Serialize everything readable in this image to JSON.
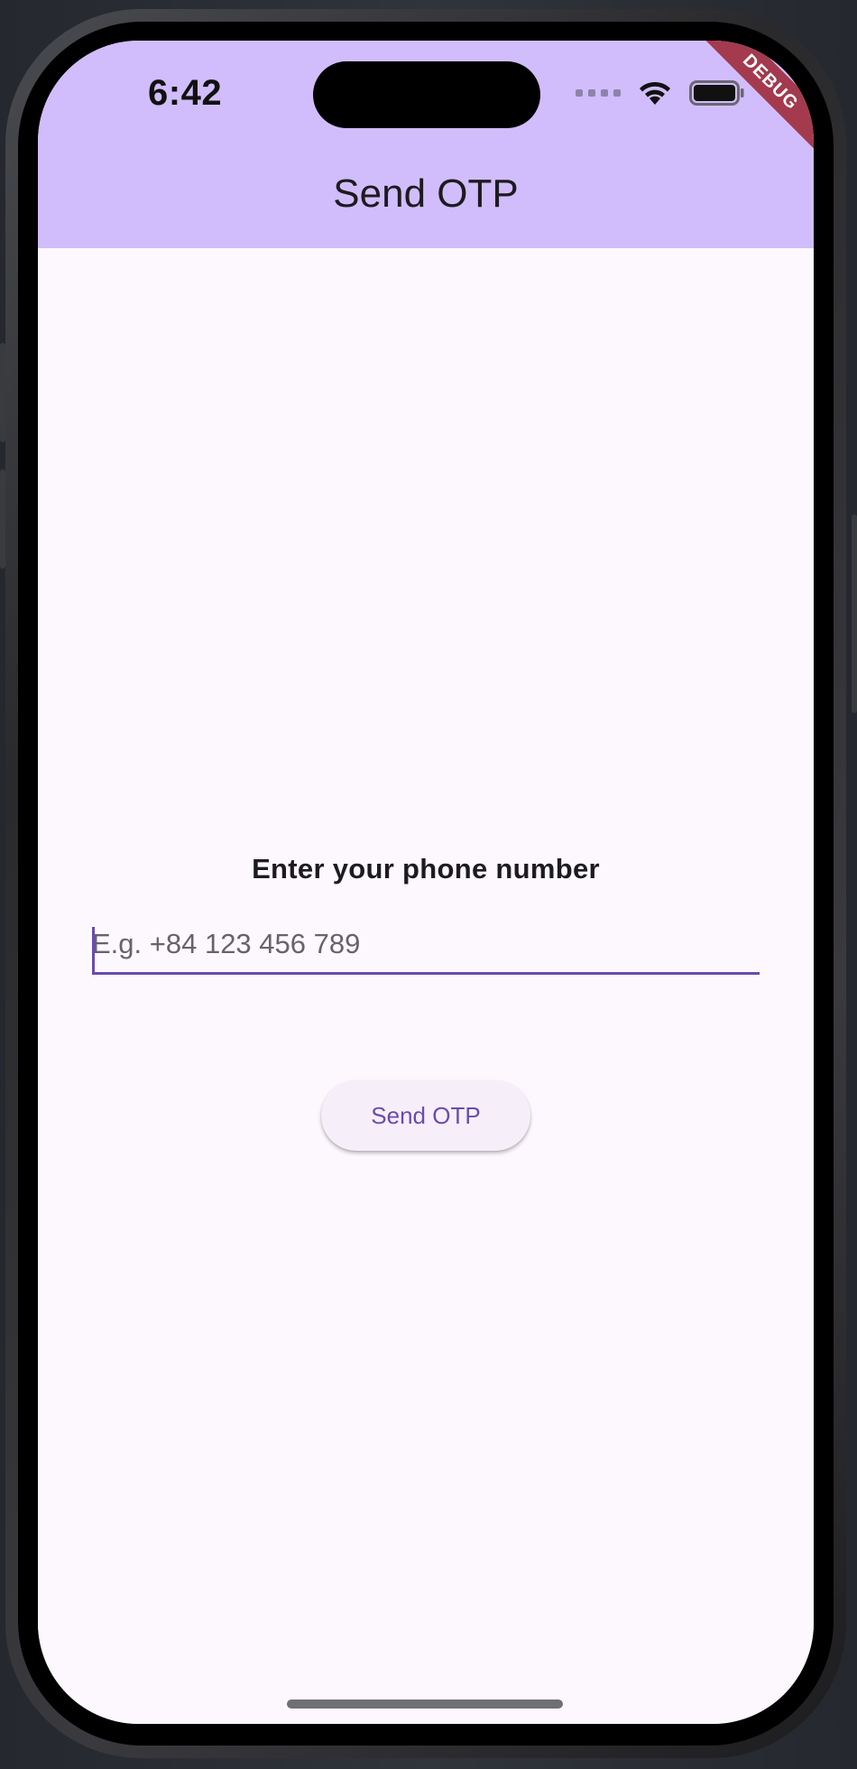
{
  "status_bar": {
    "time": "6:42",
    "icons": [
      "signal-dots-icon",
      "wifi-icon",
      "battery-icon"
    ]
  },
  "debug_banner": "DEBUG",
  "app_bar": {
    "title": "Send OTP"
  },
  "form": {
    "label": "Enter your phone number",
    "phone_input": {
      "value": "",
      "placeholder": "E.g. +84 123 456 789"
    },
    "send_button_label": "Send OTP"
  },
  "colors": {
    "app_bar_bg": "#d1bdfb",
    "accent": "#6a4bb0",
    "page_bg": "#fdf8fe",
    "debug_ribbon": "#a33a4e"
  }
}
